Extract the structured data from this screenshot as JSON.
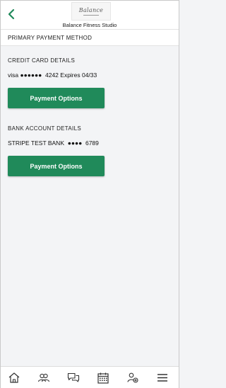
{
  "header": {
    "studio_name": "Balance Fitness Studio",
    "logo_text": "Balance",
    "back_icon": "chevron-left-icon",
    "accent": "#208a5a"
  },
  "section": {
    "title": "PRIMARY PAYMENT METHOD"
  },
  "credit_card": {
    "label": "CREDIT CARD DETAILS",
    "detail": "visa ●●●●●●  4242 Expires 04/33",
    "button_label": "Payment Options"
  },
  "bank_account": {
    "label": "BANK ACCOUNT DETAILS",
    "detail": "STRIPE TEST BANK  ●●●●  6789",
    "button_label": "Payment Options"
  },
  "bottom_nav": {
    "items": [
      {
        "icon": "home-icon"
      },
      {
        "icon": "users-icon"
      },
      {
        "icon": "chat-icon"
      },
      {
        "icon": "calendar-icon"
      },
      {
        "icon": "account-icon"
      },
      {
        "icon": "menu-icon"
      }
    ]
  },
  "colors": {
    "button": "#208a5a",
    "background": "#f3f4f6"
  }
}
